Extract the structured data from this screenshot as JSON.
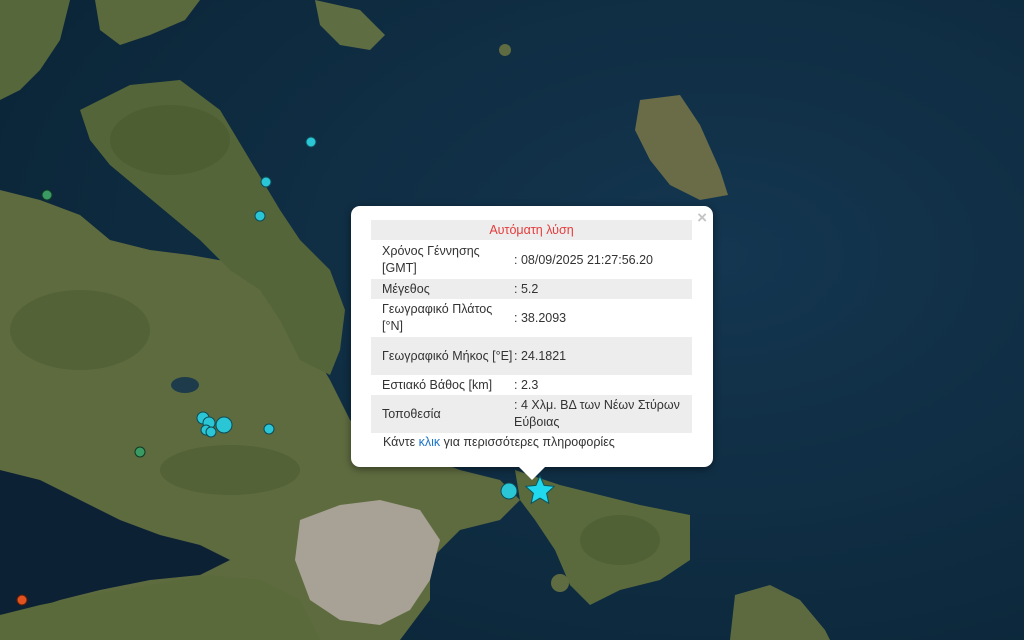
{
  "popup": {
    "title": "Αυτόματη λύση",
    "close_glyph": "×",
    "rows": [
      {
        "label": "Χρόνος Γέννησης [GMT]",
        "value": ": 08/09/2025 21:27:56.20"
      },
      {
        "label": "Μέγεθος",
        "value": ": 5.2"
      },
      {
        "label": "Γεωγραφικό Πλάτος [°N]",
        "value": ": 38.2093"
      },
      {
        "label": "Γεωγραφικό Μήκος [°E]",
        "value": ": 24.1821"
      },
      {
        "label": "Εστιακό Βάθος [km]",
        "value": ": 2.3"
      },
      {
        "label": "Τοποθεσία",
        "value": ": 4 Χλμ. ΒΔ των Νέων Στύρων Εύβοιας"
      }
    ],
    "more_before": "Κάντε ",
    "more_link": "κλικ",
    "more_after": " για περισσότερες πληροφορίες"
  },
  "markers": {
    "main_event_icon": "star-icon",
    "colors": {
      "recent": "#2ac6d6",
      "older": "#3a9a63",
      "oldest": "#e0521f",
      "main": "#21d9ee"
    }
  },
  "map_colors": {
    "sea": "#0d2a3f",
    "land": "#5a6a3c",
    "mountain": "#4a5a30",
    "urban": "#a9a397"
  }
}
